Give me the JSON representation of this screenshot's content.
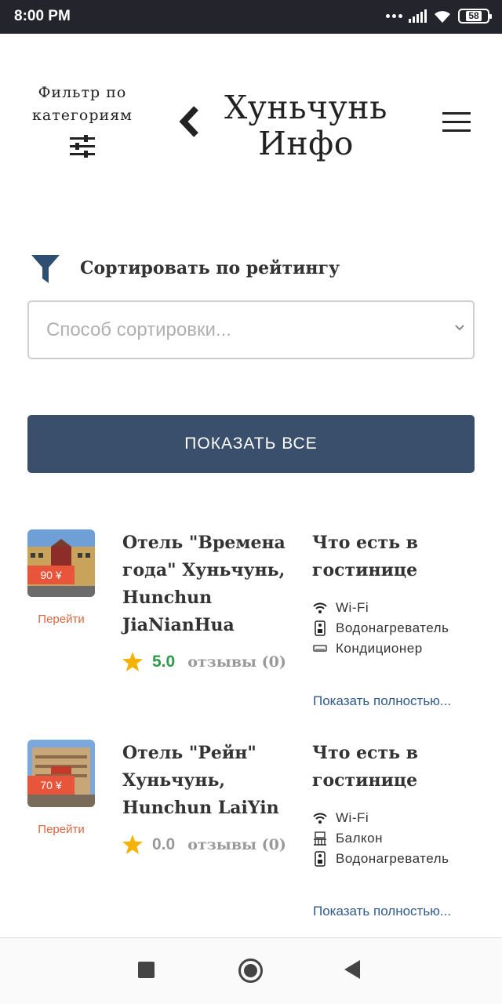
{
  "status_bar": {
    "time": "8:00 PM",
    "battery": "58",
    "icons": [
      "dots-icon",
      "signal-icon",
      "wifi-icon",
      "battery-icon"
    ]
  },
  "header": {
    "filter_label": "Фильтр по категориям",
    "filter_icon": "sliders-icon",
    "back_icon": "chevron-left-icon",
    "title": "Хуньчунь Инфо",
    "menu_icon": "hamburger-icon"
  },
  "sort": {
    "icon": "funnel-icon",
    "label": "Сортировать по рейтингу",
    "placeholder": "Способ сортировки..."
  },
  "show_all_label": "ПОКАЗАТЬ ВСЕ",
  "hotels": [
    {
      "price": "90 ¥",
      "go_label": "Перейти",
      "name": "Отель \"Времена года\" Хуньчунь, Hunchun JiaNianHua",
      "rating": "5.0",
      "reviews": "отзывы (0)",
      "amenities_title": "Что есть в гостинице",
      "amenities": [
        {
          "icon": "wifi-icon",
          "label": "Wi-Fi"
        },
        {
          "icon": "water-heater-icon",
          "label": "Водонагреватель"
        },
        {
          "icon": "air-conditioner-icon",
          "label": "Кондиционер"
        }
      ],
      "show_full": "Показать полностью..."
    },
    {
      "price": "70 ¥",
      "go_label": "Перейти",
      "name": "Отель \"Рейн\" Хуньчунь, Hunchun LaiYin",
      "rating": "0.0",
      "reviews": "отзывы (0)",
      "amenities_title": "Что есть в гостинице",
      "amenities": [
        {
          "icon": "wifi-icon",
          "label": "Wi-Fi"
        },
        {
          "icon": "balcony-icon",
          "label": "Балкон"
        },
        {
          "icon": "water-heater-icon",
          "label": "Водонагреватель"
        }
      ],
      "show_full": "Показать полностью..."
    }
  ],
  "colors": {
    "status_bar": "#24242d",
    "button": "#3a4f6b",
    "price_badge": "#e8553a",
    "link": "#2f5a8a",
    "go_link": "#d9673f",
    "rating_good": "#2e9a4a",
    "rating_zero": "#999999",
    "star": "#f5b301"
  },
  "nav": {
    "icons": [
      "recent-apps-icon",
      "home-icon",
      "back-icon"
    ]
  }
}
